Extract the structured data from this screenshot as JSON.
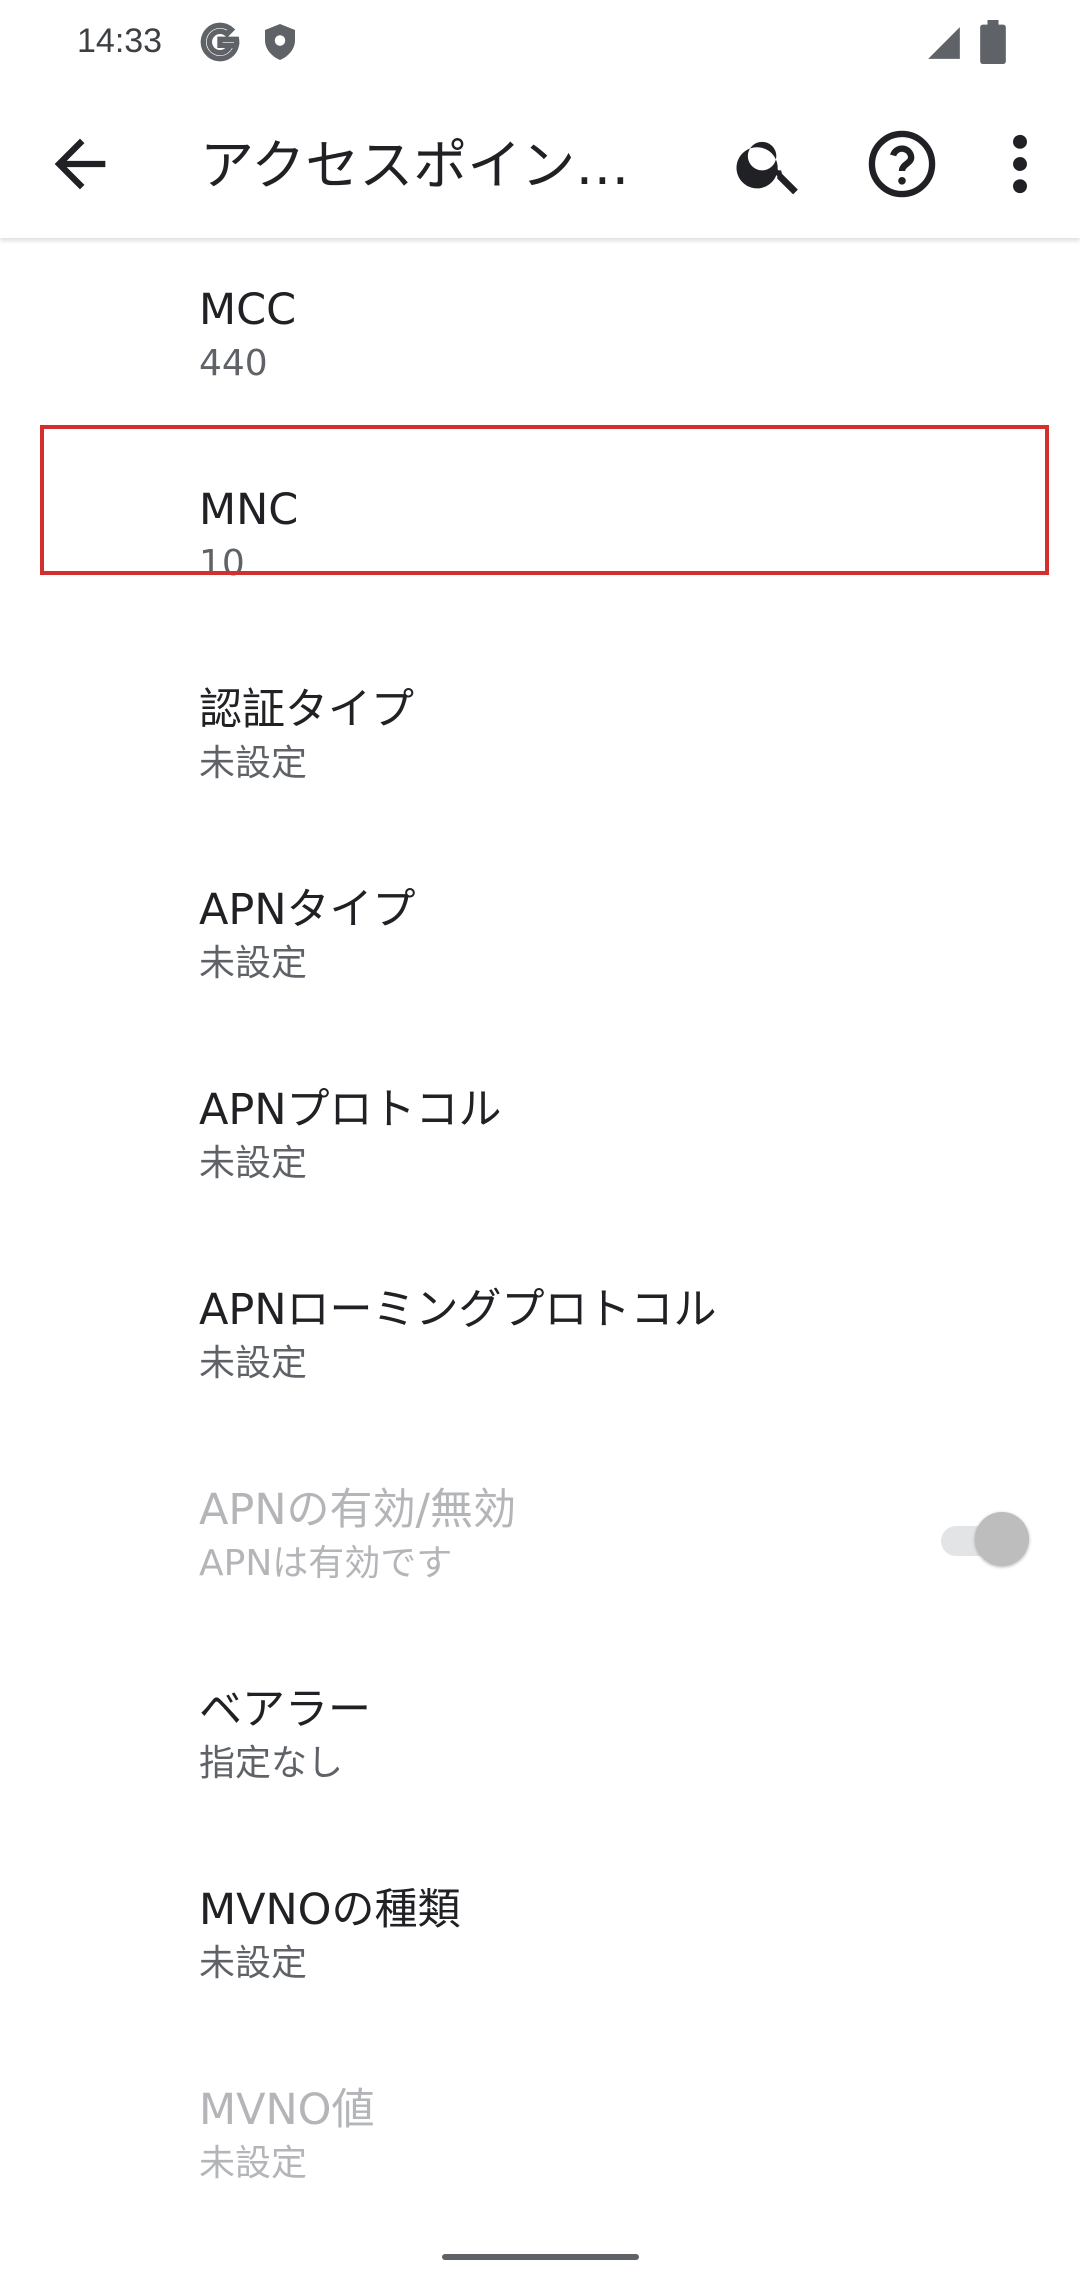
{
  "status_bar": {
    "time": "14:33",
    "icons": [
      "google-g-icon",
      "shield-icon",
      "signal-icon",
      "battery-icon"
    ]
  },
  "app_bar": {
    "title": "アクセスポイント…",
    "back_icon": "arrow-back-icon",
    "actions": [
      "search-icon",
      "help-icon",
      "more-vert-icon"
    ]
  },
  "preferences": [
    {
      "title": "MCC",
      "summary": "440",
      "enabled": true
    },
    {
      "title": "MNC",
      "summary": "10",
      "enabled": true
    },
    {
      "title": "認証タイプ",
      "summary": "未設定",
      "enabled": true,
      "highlighted": true
    },
    {
      "title": "APNタイプ",
      "summary": "未設定",
      "enabled": true
    },
    {
      "title": "APNプロトコル",
      "summary": "未設定",
      "enabled": true
    },
    {
      "title": "APNローミングプロトコル",
      "summary": "未設定",
      "enabled": true
    },
    {
      "title": "APNの有効/無効",
      "summary": "APNは有効です",
      "enabled": false,
      "toggle": {
        "checked": true
      }
    },
    {
      "title": "ベアラー",
      "summary": "指定なし",
      "enabled": true
    },
    {
      "title": "MVNOの種類",
      "summary": "未設定",
      "enabled": true
    },
    {
      "title": "MVNO値",
      "summary": "未設定",
      "enabled": false
    }
  ],
  "colors": {
    "highlight_border": "#d32f2f",
    "primary_text": "#202124",
    "secondary_text": "#5f6368",
    "disabled_text": "#b3b5b8"
  }
}
